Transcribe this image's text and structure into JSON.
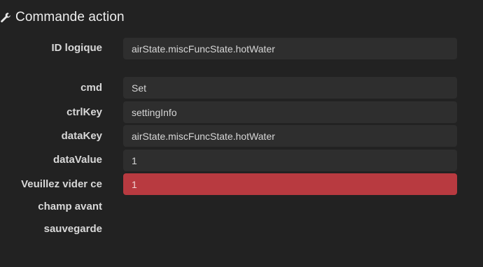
{
  "header": {
    "icon": "wrench-icon",
    "title": "Commande action"
  },
  "form": {
    "logical_id": {
      "label": "ID logique",
      "value": "airState.miscFuncState.hotWater"
    },
    "cmd": {
      "label": "cmd",
      "value": "Set"
    },
    "ctrlKey": {
      "label": "ctrlKey",
      "value": "settingInfo"
    },
    "dataKey": {
      "label": "dataKey",
      "value": "airState.miscFuncState.hotWater"
    },
    "dataValue": {
      "label": "dataValue",
      "value": "1"
    },
    "clear_field": {
      "label_line1": "Veuillez vider ce",
      "label_line2": "champ avant",
      "label_line3": "sauvegarde",
      "value": "1"
    }
  },
  "colors": {
    "background": "#222222",
    "field_background": "#2e2e2e",
    "error_field": "#b83a40"
  }
}
